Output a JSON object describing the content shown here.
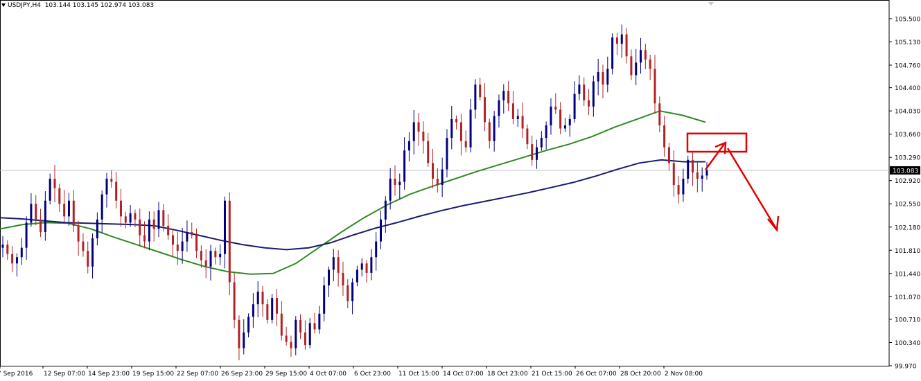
{
  "chart_header": {
    "symbol_timeframe": "USDJPY,H4",
    "ohlc": "103.144 103.145 102.974 103.083"
  },
  "colors": {
    "bull": "#000080",
    "bear": "#b22222",
    "ma_fast": "#2e8b22",
    "ma_slow": "#1a1a6e",
    "current_price_line": "#c0c0c0",
    "annotation": "#e00000"
  },
  "chart_data": {
    "type": "candlestick",
    "symbol": "USDJPY",
    "timeframe": "H4",
    "ylim": [
      99.97,
      105.72
    ],
    "y_ticks": [
      105.5,
      105.13,
      104.76,
      104.4,
      104.03,
      103.66,
      103.29,
      102.92,
      102.55,
      102.18,
      101.81,
      101.44,
      101.07,
      100.71,
      100.34,
      99.97
    ],
    "y_tick_labels": [
      "105.500",
      "105.130",
      "104.760",
      "104.400",
      "104.030",
      "103.660",
      "103.290",
      "102.920",
      "102.550",
      "102.180",
      "101.810",
      "101.440",
      "101.070",
      "100.710",
      "100.340",
      "99.970"
    ],
    "x_tick_labels": [
      "7 Sep 2016",
      "12 Sep 07:00",
      "14 Sep 23:00",
      "19 Sep 15:00",
      "22 Sep 07:00",
      "26 Sep 23:00",
      "29 Sep 15:00",
      "4 Oct 07:00",
      "6 Oct 23:00",
      "11 Oct 15:00",
      "14 Oct 07:00",
      "18 Oct 23:00",
      "21 Oct 15:00",
      "26 Oct 07:00",
      "28 Oct 20:00",
      "2 Nov 08:00"
    ],
    "current_price": 103.083,
    "current_price_label": "103.083",
    "closes": [
      101.9,
      101.75,
      101.6,
      101.7,
      101.85,
      102.25,
      102.55,
      102.3,
      102.1,
      102.6,
      102.95,
      102.8,
      102.55,
      102.35,
      102.6,
      102.2,
      101.95,
      101.8,
      101.55,
      102.0,
      102.3,
      102.7,
      102.95,
      102.9,
      102.6,
      102.35,
      102.25,
      102.4,
      102.3,
      102.05,
      101.95,
      102.3,
      102.15,
      102.45,
      102.2,
      102.05,
      101.9,
      101.8,
      101.95,
      102.1,
      102.05,
      101.8,
      101.65,
      101.55,
      101.8,
      101.7,
      101.75,
      102.6,
      101.3,
      100.7,
      100.25,
      100.5,
      100.75,
      100.95,
      101.15,
      100.95,
      100.7,
      101.05,
      100.8,
      100.45,
      100.35,
      100.25,
      100.7,
      100.5,
      100.3,
      100.65,
      100.55,
      100.8,
      101.25,
      101.5,
      101.7,
      101.45,
      101.25,
      101.0,
      101.3,
      101.5,
      101.6,
      101.45,
      101.7,
      101.95,
      102.3,
      102.6,
      102.95,
      102.85,
      102.9,
      103.4,
      103.55,
      103.85,
      103.7,
      103.55,
      103.2,
      102.95,
      102.85,
      103.1,
      103.6,
      103.9,
      103.85,
      103.55,
      103.45,
      104.05,
      104.45,
      104.25,
      103.85,
      103.55,
      103.95,
      104.2,
      104.35,
      104.15,
      103.9,
      103.95,
      103.75,
      103.5,
      103.25,
      103.45,
      103.6,
      103.8,
      104.1,
      104.05,
      103.75,
      103.8,
      103.9,
      104.3,
      104.45,
      104.2,
      104.1,
      104.5,
      104.65,
      104.45,
      104.7,
      105.2,
      105.1,
      105.25,
      104.9,
      104.6,
      104.8,
      105.0,
      104.85,
      104.7,
      104.15,
      103.8,
      103.45,
      103.2,
      102.85,
      102.7,
      102.95,
      103.25,
      103.05,
      102.95,
      103.0,
      103.083
    ],
    "series": [
      {
        "name": "",
        "kind": "moving_average_fast",
        "values": [
          102.15,
          102.22,
          102.25,
          102.24,
          102.15,
          102.02,
          101.9,
          101.78,
          101.66,
          101.55,
          101.47,
          101.43,
          101.44,
          101.6,
          101.85,
          102.1,
          102.33,
          102.53,
          102.7,
          102.83,
          102.95,
          103.07,
          103.18,
          103.29,
          103.4,
          103.5,
          103.62,
          103.77,
          103.9,
          104.03,
          103.96,
          103.85
        ]
      },
      {
        "name": "",
        "kind": "moving_average_slow",
        "values": [
          102.33,
          102.31,
          102.28,
          102.25,
          102.24,
          102.23,
          102.22,
          102.2,
          102.13,
          102.05,
          101.97,
          101.9,
          101.85,
          101.82,
          101.85,
          101.93,
          102.05,
          102.16,
          102.25,
          102.35,
          102.44,
          102.52,
          102.59,
          102.66,
          102.73,
          102.81,
          102.89,
          102.99,
          103.1,
          103.2,
          103.25,
          103.22,
          103.22
        ]
      }
    ],
    "annotations": [
      {
        "kind": "resistance_zone",
        "price_range": [
          103.38,
          103.67
        ]
      },
      {
        "kind": "arrow_up",
        "description": "projected bounce into zone"
      },
      {
        "kind": "arrow_down",
        "description": "projected decline"
      }
    ]
  }
}
